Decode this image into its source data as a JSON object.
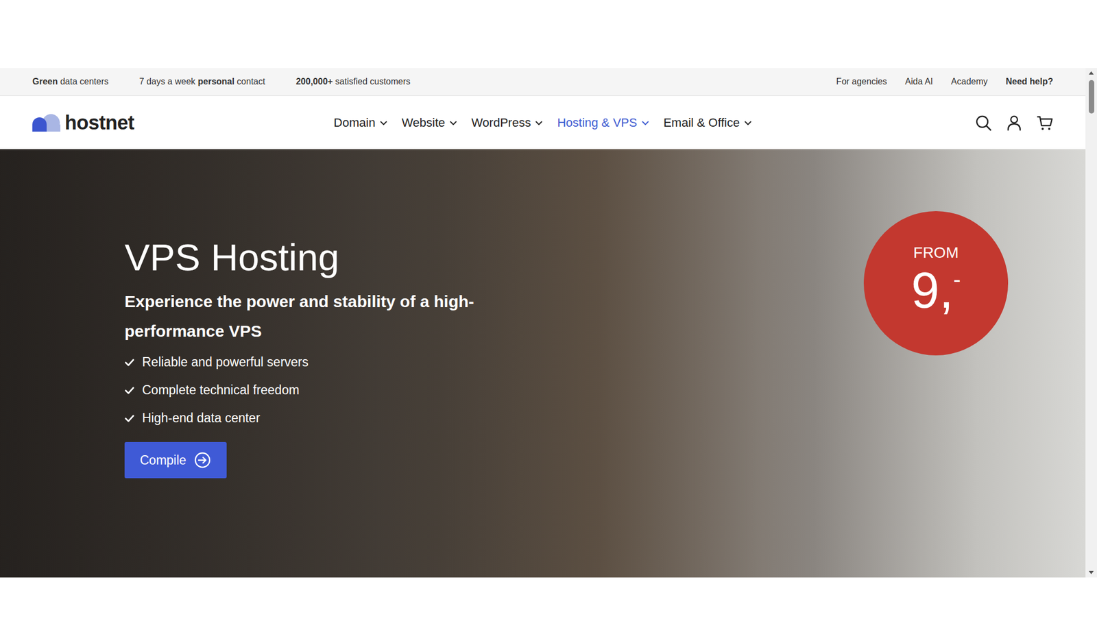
{
  "topbar": {
    "left": [
      [
        {
          "text": "Green",
          "bold": true
        },
        {
          "text": " data centers",
          "bold": false
        }
      ],
      [
        {
          "text": "7 days a week ",
          "bold": false
        },
        {
          "text": "personal",
          "bold": true
        },
        {
          "text": " contact",
          "bold": false
        }
      ],
      [
        {
          "text": "200,000+",
          "bold": true
        },
        {
          "text": " satisfied customers",
          "bold": false
        }
      ]
    ],
    "right": [
      {
        "label": "For agencies",
        "bold": false
      },
      {
        "label": "Aida AI",
        "bold": false
      },
      {
        "label": "Academy",
        "bold": false
      },
      {
        "label": "Need help?",
        "bold": true
      }
    ]
  },
  "logo": {
    "text": "hostnet"
  },
  "nav": {
    "items": [
      {
        "label": "Domain",
        "selected": false
      },
      {
        "label": "Website",
        "selected": false
      },
      {
        "label": "WordPress",
        "selected": false
      },
      {
        "label": "Hosting & VPS",
        "selected": true
      },
      {
        "label": "Email & Office",
        "selected": false
      }
    ]
  },
  "hero": {
    "title": "VPS Hosting",
    "subtitle": "Experience the power and stability of a high-performance VPS",
    "features": [
      "Reliable and powerful servers",
      "Complete technical freedom",
      "High-end data center"
    ],
    "button": {
      "label": "Compile"
    }
  },
  "price_badge": {
    "prefix": "FROM",
    "amount": "9,",
    "suffix": "-"
  },
  "scrollbar": {
    "level": 0
  }
}
